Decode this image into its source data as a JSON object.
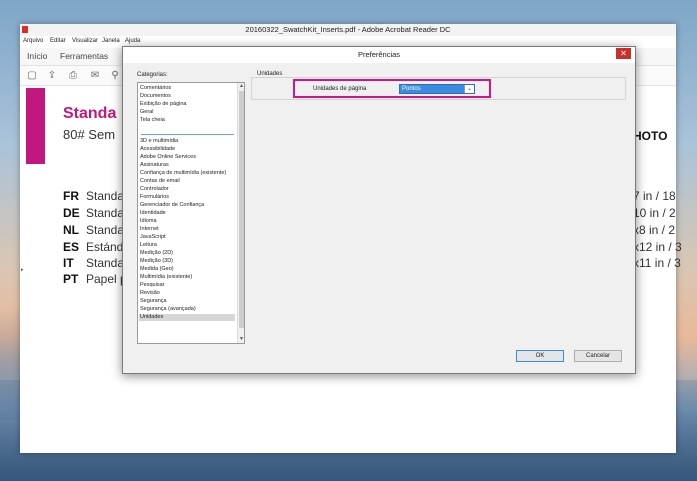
{
  "app": {
    "title": "20160322_SwatchKit_Inserts.pdf - Adobe Acrobat Reader DC",
    "menu": [
      "Arquivo",
      "Editar",
      "Visualizar",
      "Janela",
      "Ajuda"
    ],
    "nav": [
      "Início",
      "Ferramentas"
    ],
    "toolbar_icons": [
      "save-icon",
      "upload-icon",
      "print-icon",
      "email-icon",
      "search-icon"
    ]
  },
  "document": {
    "title": "Standa",
    "subtitle": "80# Sem",
    "right_heading": "HOTO",
    "rows": [
      {
        "code": "FR",
        "text": "Standa",
        "right": "7 in / 18"
      },
      {
        "code": "DE",
        "text": "Standa",
        "right": "10 in / 2"
      },
      {
        "code": "NL",
        "text": "Standa",
        "right": "x8 in / 2"
      },
      {
        "code": "ES",
        "text": "Estánd",
        "right": "x12 in / 3"
      },
      {
        "code": "IT",
        "text": "Standa",
        "right": "x11 in / 3"
      },
      {
        "code": "PT",
        "text": "Papel p",
        "right": ""
      }
    ]
  },
  "dialog": {
    "title": "Preferências",
    "close": "✕",
    "categories_label": "Categorias:",
    "categories_top": [
      "Comentários",
      "Documentos",
      "Exibição de página",
      "Geral",
      "Tela cheia"
    ],
    "categories": [
      "3D e multimídia",
      "Acessibilidade",
      "Adobe Online Services",
      "Assinaturas",
      "Confiança de multimídia (existente)",
      "Contas de email",
      "Controlador",
      "Formulários",
      "Gerenciador de Confiança",
      "Identidade",
      "Idioma",
      "Internet",
      "JavaScript",
      "Leitura",
      "Medição (2D)",
      "Medição (3D)",
      "Medida (Geo)",
      "Multimídia (existente)",
      "Pesquisar",
      "Revisão",
      "Segurança",
      "Segurança (avançada)",
      "Unidades"
    ],
    "selected_category": "Unidades",
    "units_group_label": "Unidades",
    "page_units_label": "Unidades de página",
    "page_units_value": "Pontos",
    "ok_label": "OK",
    "cancel_label": "Cancelar"
  },
  "colors": {
    "accent": "#c2177e",
    "highlight": "#d4147e",
    "select_blue": "#3b8be0"
  }
}
